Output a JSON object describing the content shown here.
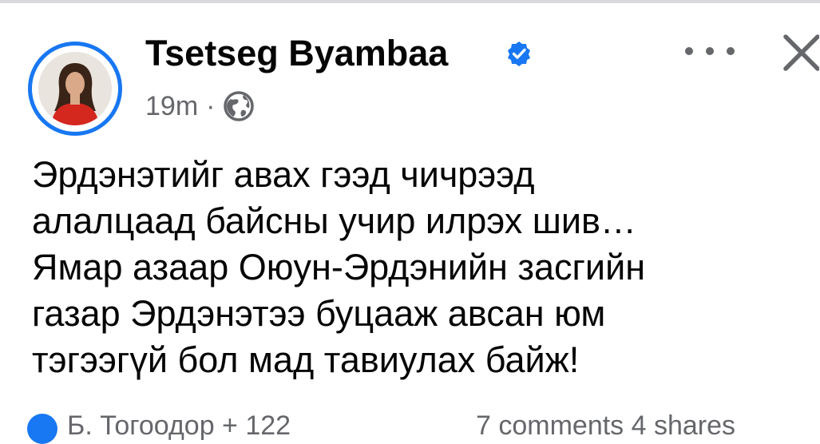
{
  "post": {
    "author": "Tsetseg Byambaa",
    "verified": true,
    "time": "19m",
    "separator": "·",
    "privacy_icon": "globe-icon",
    "text_lines": [
      "Эрдэнэтийг авах гээд чичрээд",
      "алалцаад байсны учир илрэх шив…",
      "Ямар азаар Оюун-Эрдэнийн засгийн",
      "газар Эрдэнэтээ буцааж авсан юм",
      "тэгээгүй бол мад тавиулах байж!"
    ]
  },
  "footer": {
    "reactions_text": "Б. Тогоодор + 122",
    "counts_text": "7 comments  4 shares"
  },
  "colors": {
    "accent": "#1877f2",
    "text": "#050505",
    "secondary": "#65676b"
  }
}
